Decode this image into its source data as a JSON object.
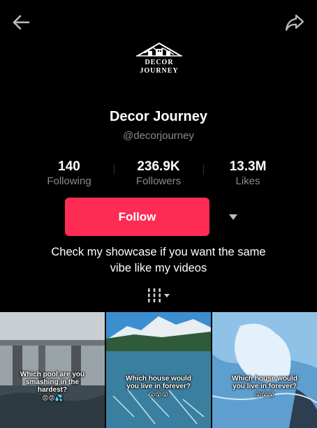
{
  "profile": {
    "logo_line1": "DECOR",
    "logo_line2": "JOURNEY",
    "name": "Decor Journey",
    "handle": "@decorjourney",
    "bio_line1": "Check my showcase if you want the same",
    "bio_line2": "vibe like my videos"
  },
  "stats": [
    {
      "value": "140",
      "label": "Following"
    },
    {
      "value": "236.9K",
      "label": "Followers"
    },
    {
      "value": "13.3M",
      "label": "Likes"
    }
  ],
  "actions": {
    "follow_label": "Follow"
  },
  "colors": {
    "accent": "#fe2c55",
    "secondary_text": "#8a8a8a",
    "background": "#000000"
  },
  "videos": [
    {
      "caption_l1": "Which pool are you",
      "caption_l2": "smashing in the",
      "caption_l3": "hardest?",
      "emoji": "😡😡💦"
    },
    {
      "caption_l1": "Which house would",
      "caption_l2": "you live in forever?",
      "caption_l3": "",
      "emoji": "😮😮😮"
    },
    {
      "caption_l1": "Which house would",
      "caption_l2": "you live in forever?",
      "caption_l3": "",
      "emoji": "😮😮😮"
    }
  ],
  "icons": {
    "back": "arrow-left-icon",
    "share": "share-arrow-icon",
    "more": "caret-down-icon",
    "grid": "grid-icon"
  }
}
